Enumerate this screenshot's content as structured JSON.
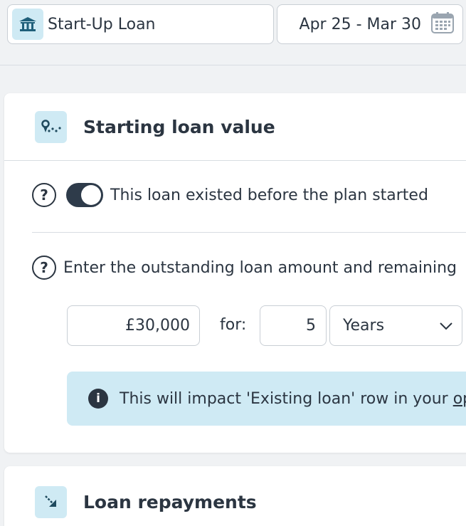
{
  "topbar": {
    "loan_name": "Start-Up Loan",
    "loan_icon": "bank-icon",
    "date_range": "Apr 25 - Mar 30",
    "date_icon": "calendar-icon"
  },
  "starting_card": {
    "title": "Starting loan value",
    "icon": "route-icon",
    "existed_help": "?",
    "existed_label": "This loan existed before the plan started",
    "existed_toggle_on": true,
    "amount_help": "?",
    "amount_label": "Enter the outstanding loan amount and remaining",
    "amount_value": "£30,000",
    "for_label": "for:",
    "term_value": "5",
    "term_unit": "Years",
    "info_icon": "i",
    "info_text": "This will impact 'Existing loan' row in your ",
    "info_link": "op"
  },
  "repayments_card": {
    "title": "Loan repayments",
    "icon": "arrow-down-right-icon"
  },
  "colors": {
    "accent_light": "#cfeaf4",
    "dark": "#2b3541",
    "toggle": "#2e3b4a"
  }
}
